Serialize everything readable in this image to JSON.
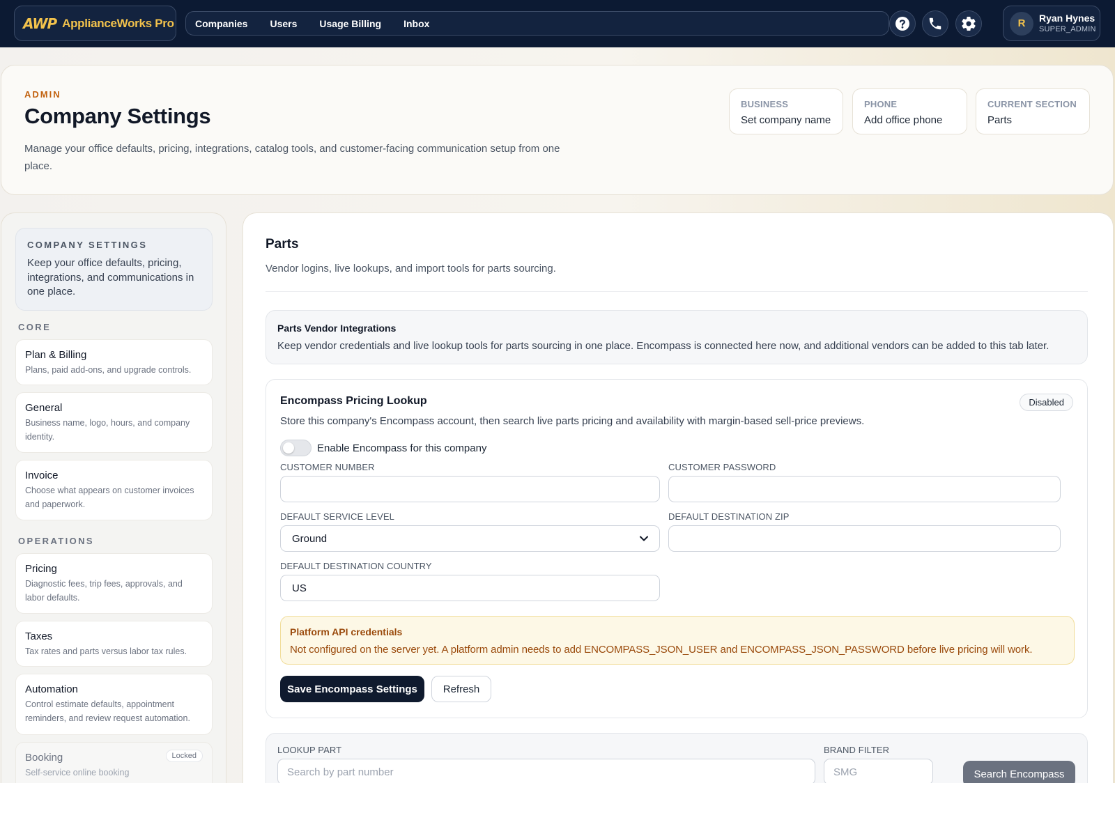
{
  "topnav": {
    "brand_logo": "AWP",
    "brand_name": "ApplianceWorks Pro",
    "links": [
      "Companies",
      "Users",
      "Usage Billing",
      "Inbox"
    ],
    "icons": [
      "help-icon",
      "phone-icon",
      "settings-icon"
    ],
    "user": {
      "initial": "R",
      "name": "Ryan Hynes",
      "role": "SUPER_ADMIN"
    }
  },
  "header": {
    "eyebrow": "ADMIN",
    "title": "Company Settings",
    "description": "Manage your office defaults, pricing, integrations, catalog tools, and customer-facing communication setup from one place.",
    "stats": [
      {
        "label": "BUSINESS",
        "value": "Set company name"
      },
      {
        "label": "PHONE",
        "value": "Add office phone"
      },
      {
        "label": "CURRENT SECTION",
        "value": "Parts"
      }
    ]
  },
  "sidebar": {
    "intro_title": "COMPANY SETTINGS",
    "intro_text": "Keep your office defaults, pricing, integrations, and communications in one place.",
    "groups": [
      {
        "label": "CORE",
        "items": [
          {
            "title": "Plan & Billing",
            "desc": "Plans, paid add-ons, and upgrade controls."
          },
          {
            "title": "General",
            "desc": "Business name, logo, hours, and company identity."
          },
          {
            "title": "Invoice",
            "desc": "Choose what appears on customer invoices and paperwork."
          }
        ]
      },
      {
        "label": "OPERATIONS",
        "items": [
          {
            "title": "Pricing",
            "desc": "Diagnostic fees, trip fees, approvals, and labor defaults."
          },
          {
            "title": "Taxes",
            "desc": "Tax rates and parts versus labor tax rules."
          },
          {
            "title": "Automation",
            "desc": "Control estimate defaults, appointment reminders, and review request automation."
          },
          {
            "title": "Booking",
            "desc": "Self-service online booking",
            "badge": "Locked"
          }
        ]
      }
    ]
  },
  "main": {
    "title": "Parts",
    "subtitle": "Vendor logins, live lookups, and import tools for parts sourcing.",
    "vendor_box": {
      "title": "Parts Vendor Integrations",
      "text": "Keep vendor credentials and live lookup tools for parts sourcing in one place. Encompass is connected here now, and additional vendors can be added to this tab later."
    },
    "encompass": {
      "title": "Encompass Pricing Lookup",
      "status": "Disabled",
      "description": "Store this company's Encompass account, then search live parts pricing and availability with margin-based sell-price previews.",
      "toggle_label": "Enable Encompass for this company",
      "toggle_on": false,
      "fields": {
        "customer_number": {
          "label": "CUSTOMER NUMBER",
          "value": ""
        },
        "customer_password": {
          "label": "CUSTOMER PASSWORD",
          "value": ""
        },
        "service_level": {
          "label": "DEFAULT SERVICE LEVEL",
          "value": "Ground"
        },
        "destination_zip": {
          "label": "DEFAULT DESTINATION ZIP",
          "value": ""
        },
        "destination_country": {
          "label": "DEFAULT DESTINATION COUNTRY",
          "value": "US"
        }
      },
      "alert": {
        "title": "Platform API credentials",
        "text": "Not configured on the server yet. A platform admin needs to add ENCOMPASS_JSON_USER and ENCOMPASS_JSON_PASSWORD before live pricing will work."
      },
      "save_label": "Save Encompass Settings",
      "refresh_label": "Refresh"
    },
    "lookup": {
      "part_label": "LOOKUP PART",
      "part_placeholder": "Search by part number",
      "brand_label": "BRAND FILTER",
      "brand_placeholder": "SMG",
      "search_label": "Search Encompass"
    }
  }
}
